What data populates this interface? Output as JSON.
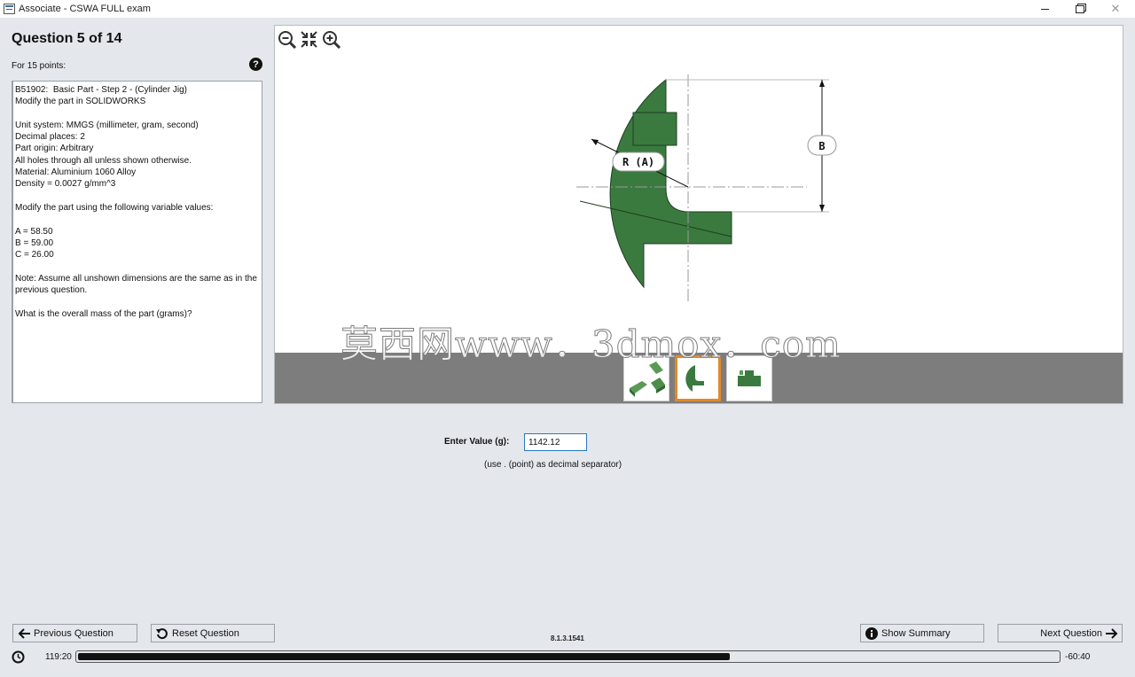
{
  "window": {
    "title": "Associate - CSWA FULL exam",
    "close_glyph": "✕"
  },
  "question": {
    "title": "Question 5 of 14",
    "points": "For 15 points:",
    "help_glyph": "?",
    "text": "B51902:  Basic Part - Step 2 - (Cylinder Jig)\nModify the part in SOLIDWORKS\n\nUnit system: MMGS (millimeter, gram, second)\nDecimal places: 2\nPart origin: Arbitrary\nAll holes through all unless shown otherwise.\nMaterial: Aluminium 1060 Alloy\nDensity = 0.0027 g/mm^3\n\nModify the part using the following variable values:\n\nA = 58.50\nB = 59.00\nC = 26.00\n\nNote: Assume all unshown dimensions are the same as in the previous question.\n\nWhat is the overall mass of the part (grams)?"
  },
  "viewer": {
    "tools": [
      "zoom-out-icon",
      "fit-to-screen-icon",
      "zoom-in-icon"
    ],
    "drawing": {
      "dim_radius_label": "R (A)",
      "dim_b_label": "B",
      "part_color": "#3b7a3f"
    },
    "thumbnails": [
      {
        "name": "isometric-view",
        "active": false
      },
      {
        "name": "front-view",
        "active": true
      },
      {
        "name": "top-view",
        "active": false
      }
    ],
    "watermark": "莫西网www．3dmox．com"
  },
  "answer": {
    "label": "Enter Value (g):",
    "value": "1142.12",
    "hint": "(use . (point) as decimal separator)"
  },
  "footer": {
    "prev_label": "Previous Question",
    "reset_label": "Reset Question",
    "summary_label": "Show Summary",
    "next_label": "Next Question",
    "version": "8.1.3.1541",
    "time_remaining": "119:20",
    "time_over": "-60:40",
    "progress": 0.665
  }
}
